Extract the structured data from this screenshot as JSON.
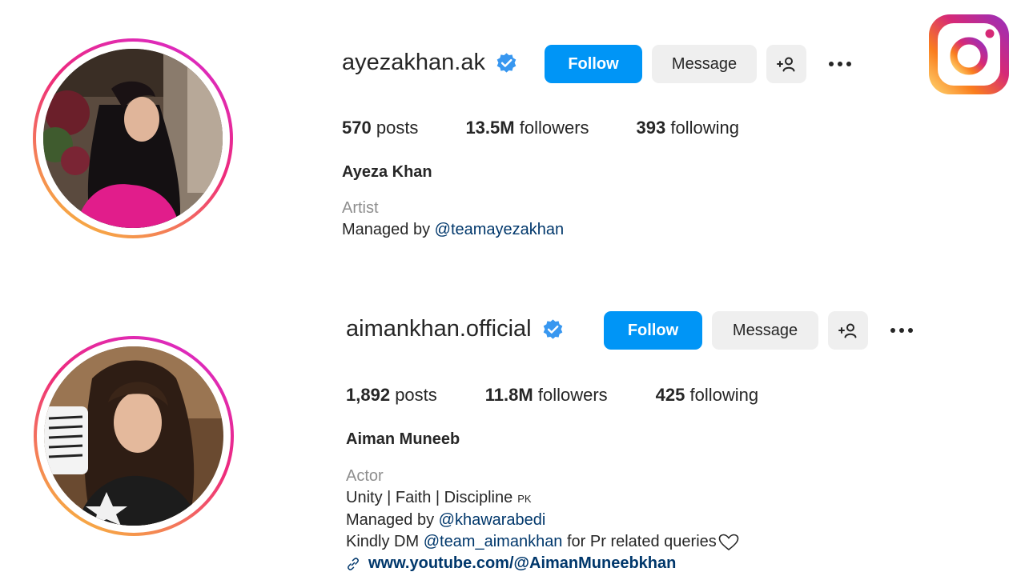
{
  "logo": {
    "icon": "instagram-logo-icon"
  },
  "profiles": [
    {
      "username": "ayezakhan.ak",
      "verified_icon": "verified-badge-icon",
      "follow_label": "Follow",
      "message_label": "Message",
      "suggest_label": "+☺",
      "posts_count": "570",
      "posts_label": "posts",
      "followers_count": "13.5M",
      "followers_label": "followers",
      "following_count": "393",
      "following_label": "following",
      "full_name": "Ayeza Khan",
      "category": "Artist",
      "bio_managed_prefix": "Managed by",
      "bio_managed_handle": "@teamayezakhan"
    },
    {
      "username": "aimankhan.official",
      "verified_icon": "verified-badge-icon",
      "follow_label": "Follow",
      "message_label": "Message",
      "posts_count": "1,892",
      "posts_label": "posts",
      "followers_count": "11.8M",
      "followers_label": "followers",
      "following_count": "425",
      "following_label": "following",
      "full_name": "Aiman Muneeb",
      "category": "Actor",
      "bio_line1": "Unity | Faith | Discipline",
      "bio_line1_flag": "PK",
      "bio_managed_prefix": "Managed by",
      "bio_managed_handle": "@khawarabedi",
      "bio_dm_prefix": "Kindly DM",
      "bio_dm_handle": "@team_aimankhan",
      "bio_dm_suffix": "for Pr related queries",
      "link": "www.youtube.com/@AimanMuneebkhan"
    }
  ],
  "colors": {
    "follow_button": "#0095f6",
    "secondary_button": "#efefef",
    "verified": "#3897f0",
    "mention": "#00376b",
    "category": "#8e8e8e"
  }
}
